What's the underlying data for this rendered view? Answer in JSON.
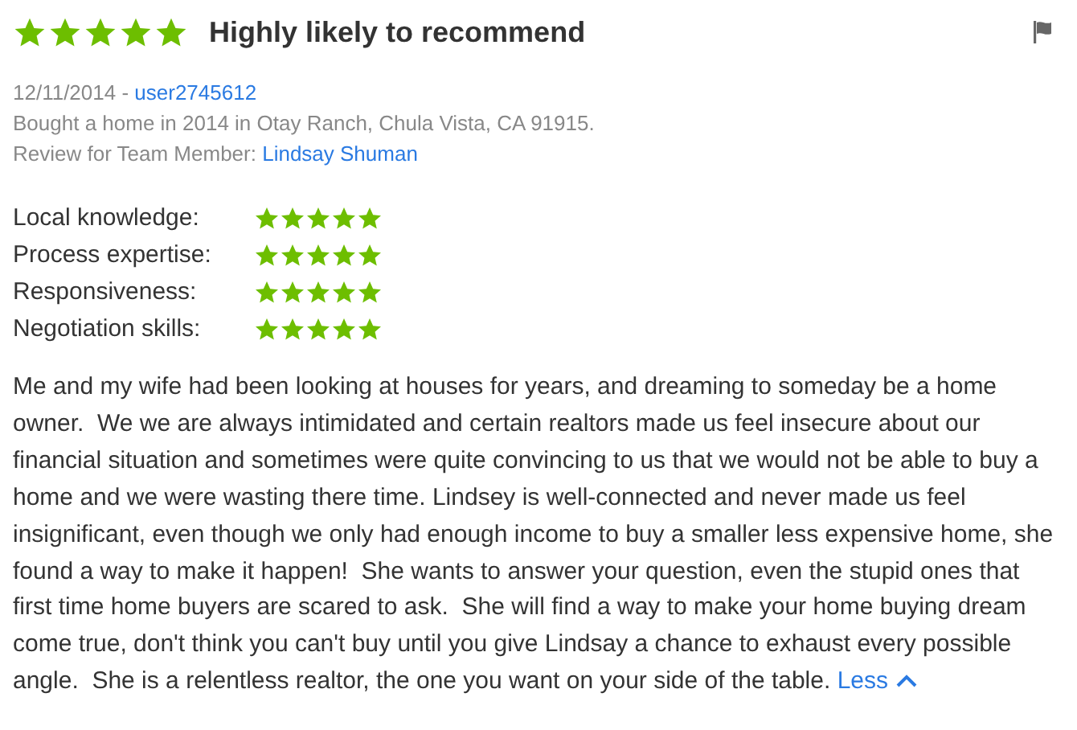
{
  "review": {
    "stars": 5,
    "title": "Highly likely to recommend",
    "date": "12/11/2014 - ",
    "user": "user2745612",
    "bought": "Bought a home in 2014 in Otay Ranch, Chula Vista, CA 91915.",
    "team_label": "Review for Team Member: ",
    "team_member": "Lindsay Shuman"
  },
  "ratings": [
    {
      "label": "Local knowledge:",
      "stars": 5
    },
    {
      "label": "Process expertise:",
      "stars": 5
    },
    {
      "label": "Responsiveness:",
      "stars": 5
    },
    {
      "label": "Negotiation skills:",
      "stars": 5
    }
  ],
  "body": "Me and my wife had been looking at houses for years, and dreaming to someday be a home owner.  We we are always intimidated and certain realtors made us feel insecure about our financial situation and sometimes were quite convincing to us that we would not be able to buy a home and we were wasting there time. Lindsey is well-connected and never made us feel insignificant, even though we only had enough income to buy a smaller less expensive home, she found a way to make it happen!  She wants to answer your question, even the stupid ones that first time home buyers are scared to ask.  She will find a way to make your home buying dream come true, don't think you can't buy until you give Lindsay a chance to exhaust every possible angle.  She is a relentless realtor, the one you want on your side of the table.",
  "less_link": "Less"
}
